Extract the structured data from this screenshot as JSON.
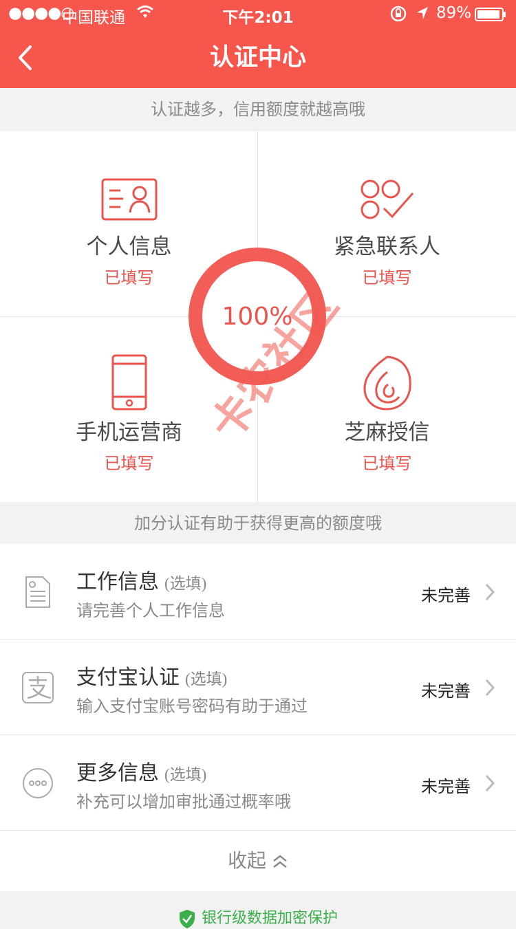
{
  "status_bar": {
    "signal": "●●●●○",
    "carrier": "中国联通",
    "time": "下午2:01",
    "battery": "89%"
  },
  "header": {
    "title": "认证中心",
    "accent_color": "#f7564d"
  },
  "banner_top": "认证越多，信用额度就越高哦",
  "required_items": [
    {
      "label": "个人信息",
      "status": "已填写",
      "icon": "id-card-icon"
    },
    {
      "label": "紧急联系人",
      "status": "已填写",
      "icon": "contacts-check-icon"
    },
    {
      "label": "手机运营商",
      "status": "已填写",
      "icon": "mobile-phone-icon"
    },
    {
      "label": "芝麻授信",
      "status": "已填写",
      "icon": "sesame-credit-icon"
    }
  ],
  "progress": {
    "text": "100%",
    "value": 1.0
  },
  "banner_bonus": "加分认证有助于获得更高的额度哦",
  "optional_items": [
    {
      "title": "工作信息",
      "tag": "(选填)",
      "desc": "请完善个人工作信息",
      "status": "未完善",
      "icon": "document-icon"
    },
    {
      "title": "支付宝认证",
      "tag": "(选填)",
      "desc": "输入支付宝账号密码有助于通过",
      "status": "未完善",
      "icon": "alipay-icon"
    },
    {
      "title": "更多信息",
      "tag": "(选填)",
      "desc": "补充可以增加审批通过概率哦",
      "status": "未完善",
      "icon": "more-dots-icon"
    }
  ],
  "collapse_label": "收起",
  "footer_text": "银行级数据加密保护",
  "watermark": "卡农社区"
}
